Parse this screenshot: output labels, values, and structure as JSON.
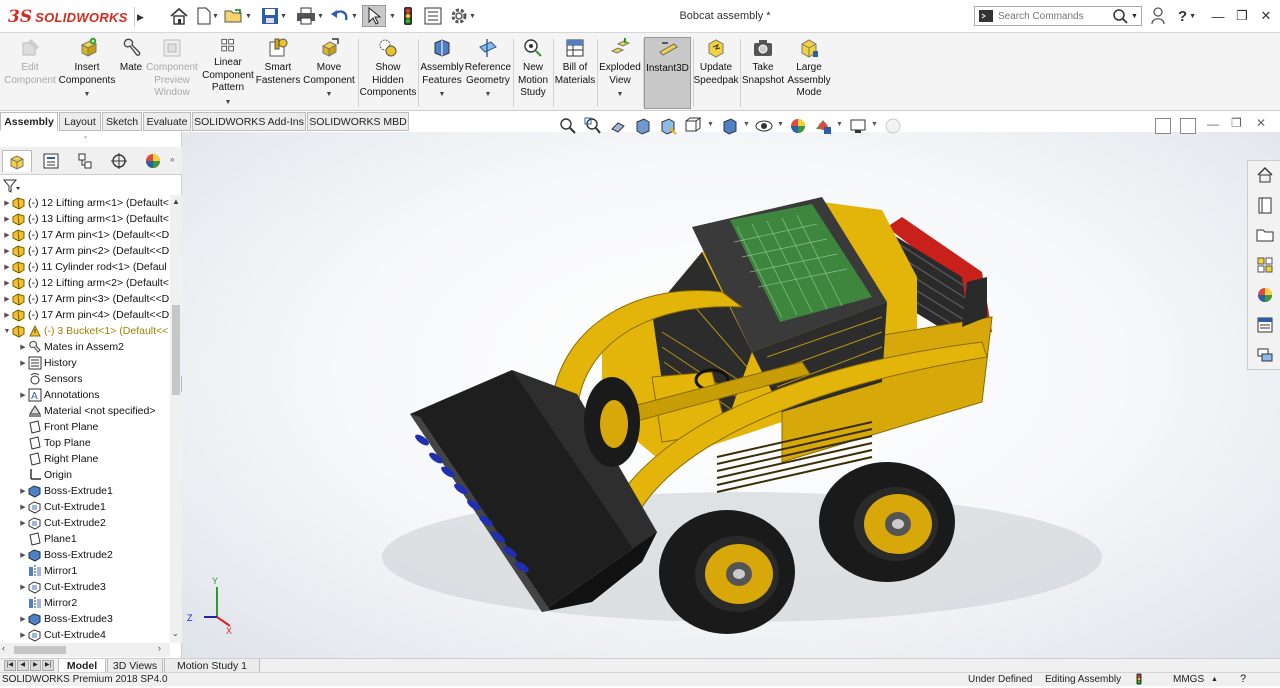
{
  "app": {
    "logo_ds": "3S",
    "logo_text": "SOLIDWORKS",
    "document_title": "Bobcat assembly *"
  },
  "search": {
    "placeholder": "Search Commands"
  },
  "quick_access": [
    "home-icon",
    "new-document-icon",
    "open-icon",
    "save-icon",
    "print-icon",
    "undo-icon",
    "select-icon",
    "rebuild-icon",
    "file-properties-icon",
    "options-icon"
  ],
  "window_controls": {
    "help": "?",
    "minimize": "—",
    "restore": "❐",
    "close": "✕"
  },
  "ribbon": {
    "commands": [
      {
        "id": "edit-component",
        "label": "Edit\nComponent",
        "icon": "edit-component-icon",
        "disabled": true
      },
      {
        "id": "insert-components",
        "label": "Insert\nComponents",
        "icon": "insert-components-icon",
        "caret": true
      },
      {
        "id": "mate",
        "label": "Mate",
        "icon": "mate-icon"
      },
      {
        "id": "component-preview-window",
        "label": "Component\nPreview\nWindow",
        "icon": "component-preview-icon",
        "disabled": true
      },
      {
        "id": "linear-component-pattern",
        "label": "Linear\nComponent\nPattern",
        "icon": "linear-pattern-icon",
        "caret": true
      },
      {
        "id": "smart-fasteners",
        "label": "Smart\nFasteners",
        "icon": "smart-fasteners-icon"
      },
      {
        "id": "move-component",
        "label": "Move\nComponent",
        "icon": "move-component-icon",
        "caret": true
      },
      {
        "id": "show-hidden-components",
        "label": "Show\nHidden\nComponents",
        "icon": "show-hidden-icon"
      },
      {
        "id": "assembly-features",
        "label": "Assembly\nFeatures",
        "icon": "assembly-features-icon",
        "caret": true
      },
      {
        "id": "reference-geometry",
        "label": "Reference\nGeometry",
        "icon": "reference-geometry-icon",
        "caret": true
      },
      {
        "id": "new-motion-study",
        "label": "New\nMotion\nStudy",
        "icon": "motion-study-icon"
      },
      {
        "id": "bill-of-materials",
        "label": "Bill of\nMaterials",
        "icon": "bom-icon"
      },
      {
        "id": "exploded-view",
        "label": "Exploded\nView",
        "icon": "exploded-view-icon",
        "caret": true
      },
      {
        "id": "instant3d",
        "label": "Instant3D",
        "icon": "instant3d-icon",
        "active": true
      },
      {
        "id": "update-speedpak",
        "label": "Update\nSpeedpak",
        "icon": "speedpak-icon"
      },
      {
        "id": "take-snapshot",
        "label": "Take\nSnapshot",
        "icon": "snapshot-icon"
      },
      {
        "id": "large-assembly-mode",
        "label": "Large\nAssembly\nMode",
        "icon": "large-assembly-icon"
      }
    ]
  },
  "command_tabs": [
    {
      "label": "Assembly",
      "selected": true
    },
    {
      "label": "Layout"
    },
    {
      "label": "Sketch"
    },
    {
      "label": "Evaluate"
    },
    {
      "label": "SOLIDWORKS Add-Ins"
    },
    {
      "label": "SOLIDWORKS MBD"
    }
  ],
  "heads_up_toolbar": [
    "zoom-to-fit-icon",
    "zoom-to-area-icon",
    "previous-view-icon",
    "section-view-icon",
    "dynamic-annotation-icon",
    "view-orientation-icon",
    "display-style-icon",
    "hide-show-items-icon",
    "edit-appearance-icon",
    "apply-scene-icon",
    "view-settings-icon",
    "realview-icon"
  ],
  "feature_tree": {
    "items": [
      {
        "label": "(-) 12 Lifting arm<1> (Default<",
        "level": 0,
        "icon": "part-icon",
        "expand": true
      },
      {
        "label": "(-) 13 Lifting arm<1> (Default<",
        "level": 0,
        "icon": "part-icon",
        "expand": true
      },
      {
        "label": "(-) 17 Arm pin<1> (Default<<D",
        "level": 0,
        "icon": "part-icon",
        "expand": true
      },
      {
        "label": "(-) 17 Arm pin<2> (Default<<D",
        "level": 0,
        "icon": "part-icon",
        "expand": true
      },
      {
        "label": "(-) 11 Cylinder rod<1> (Defaul",
        "level": 0,
        "icon": "part-icon",
        "expand": true
      },
      {
        "label": "(-) 12 Lifting arm<2> (Default<",
        "level": 0,
        "icon": "part-icon",
        "expand": true
      },
      {
        "label": "(-) 17 Arm pin<3> (Default<<D",
        "level": 0,
        "icon": "part-icon",
        "expand": true
      },
      {
        "label": "(-) 17 Arm pin<4> (Default<<D",
        "level": 0,
        "icon": "part-icon",
        "expand": true
      },
      {
        "label": "(-) 3 Bucket<1> (Default<<",
        "level": 0,
        "icon": "part-icon",
        "expand": true,
        "expanded": true,
        "warn": true
      },
      {
        "label": "Mates in Assem2",
        "level": 1,
        "icon": "mates-icon",
        "expand": true
      },
      {
        "label": "History",
        "level": 1,
        "icon": "history-icon",
        "expand": true
      },
      {
        "label": "Sensors",
        "level": 1,
        "icon": "sensors-icon"
      },
      {
        "label": "Annotations",
        "level": 1,
        "icon": "annotations-icon",
        "expand": true
      },
      {
        "label": "Material <not specified>",
        "level": 1,
        "icon": "material-icon"
      },
      {
        "label": "Front Plane",
        "level": 1,
        "icon": "plane-icon"
      },
      {
        "label": "Top Plane",
        "level": 1,
        "icon": "plane-icon"
      },
      {
        "label": "Right Plane",
        "level": 1,
        "icon": "plane-icon"
      },
      {
        "label": "Origin",
        "level": 1,
        "icon": "origin-icon"
      },
      {
        "label": "Boss-Extrude1",
        "level": 1,
        "icon": "boss-extrude-icon",
        "expand": true
      },
      {
        "label": "Cut-Extrude1",
        "level": 1,
        "icon": "cut-extrude-icon",
        "expand": true
      },
      {
        "label": "Cut-Extrude2",
        "level": 1,
        "icon": "cut-extrude-icon",
        "expand": true
      },
      {
        "label": "Plane1",
        "level": 1,
        "icon": "plane-icon"
      },
      {
        "label": "Boss-Extrude2",
        "level": 1,
        "icon": "boss-extrude-icon",
        "expand": true
      },
      {
        "label": "Mirror1",
        "level": 1,
        "icon": "mirror-icon"
      },
      {
        "label": "Cut-Extrude3",
        "level": 1,
        "icon": "cut-extrude-icon",
        "expand": true
      },
      {
        "label": "Mirror2",
        "level": 1,
        "icon": "mirror-icon"
      },
      {
        "label": "Boss-Extrude3",
        "level": 1,
        "icon": "boss-extrude-icon",
        "expand": true
      },
      {
        "label": "Cut-Extrude4",
        "level": 1,
        "icon": "cut-extrude-icon",
        "expand": true
      }
    ]
  },
  "bottom_tabs": [
    {
      "label": "Model",
      "selected": true
    },
    {
      "label": "3D Views"
    },
    {
      "label": "Motion Study 1"
    }
  ],
  "status": {
    "product": "SOLIDWORKS Premium 2018 SP4.0",
    "definition": "Under Defined",
    "mode": "Editing Assembly",
    "units": "MMGS",
    "units_caret": "▲"
  },
  "colors": {
    "brand": "#d52b1e",
    "machine_yellow": "#e6b800",
    "glass": "#3f8f3f",
    "bucket": "#1e1e1e",
    "teeth": "#1f2fb0"
  }
}
